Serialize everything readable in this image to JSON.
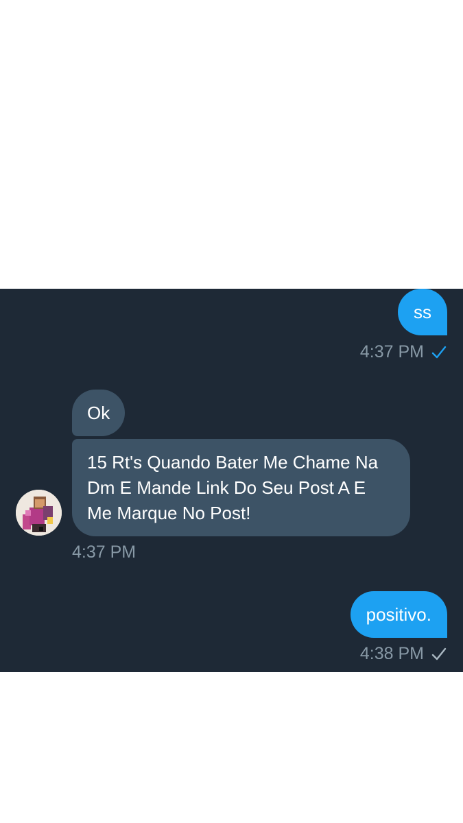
{
  "messages": [
    {
      "direction": "outgoing",
      "text": "ss",
      "time": "4:37 PM",
      "status_icon": "checkmark-icon",
      "status_color": "#1da1f2"
    },
    {
      "direction": "incoming",
      "text": "Ok"
    },
    {
      "direction": "incoming",
      "text": "15 Rt's Quando Bater Me Chame Na Dm E Mande Link Do Seu Post A E Me Marque No Post!",
      "time": "4:37 PM"
    },
    {
      "direction": "outgoing",
      "text": "positivo.",
      "time": "4:38 PM",
      "status_icon": "checkmark-icon",
      "status_color": "#aab8c2"
    }
  ],
  "colors": {
    "chat_background": "#1e2936",
    "outgoing_bubble": "#1da1f2",
    "incoming_bubble": "#3d5366",
    "timestamp": "#8899a6"
  }
}
